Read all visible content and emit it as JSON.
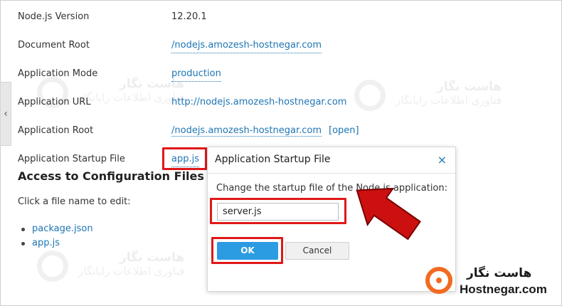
{
  "details": [
    {
      "label": "Node.js Version",
      "value": "12.20.1",
      "style": "plain"
    },
    {
      "label": "Document Root",
      "value": "/nodejs.amozesh-hostnegar.com",
      "style": "dotted"
    },
    {
      "label": "Application Mode",
      "value": "production",
      "style": "dotted"
    },
    {
      "label": "Application URL",
      "value": "http://nodejs.amozesh-hostnegar.com",
      "style": "link"
    },
    {
      "label": "Application Root",
      "value": "/nodejs.amozesh-hostnegar.com",
      "style": "dotted",
      "extra": "[open]"
    },
    {
      "label": "Application Startup File",
      "value": "app.js",
      "style": "dotted"
    }
  ],
  "config": {
    "title": "Access to Configuration Files",
    "hint": "Click a file name to edit:",
    "files": [
      "package.json",
      "app.js"
    ]
  },
  "popup": {
    "title": "Application Startup File",
    "close_icon": "×",
    "description": "Change the startup file of the Node.js application:",
    "input_value": "server.js",
    "ok_label": "OK",
    "cancel_label": "Cancel"
  },
  "side_handle_icon": "‹",
  "watermark": {
    "line1": "هاست نگار",
    "line2": "فناوری اطلاعات رایانگار"
  },
  "logo": {
    "fa": "هاست نگار",
    "en": "Hostnegar.com"
  },
  "colors": {
    "link": "#1e75b3",
    "ok_button": "#2b9be2",
    "highlight": "#e01818",
    "arrow": "#cc1010",
    "logo": "#f26a21"
  }
}
